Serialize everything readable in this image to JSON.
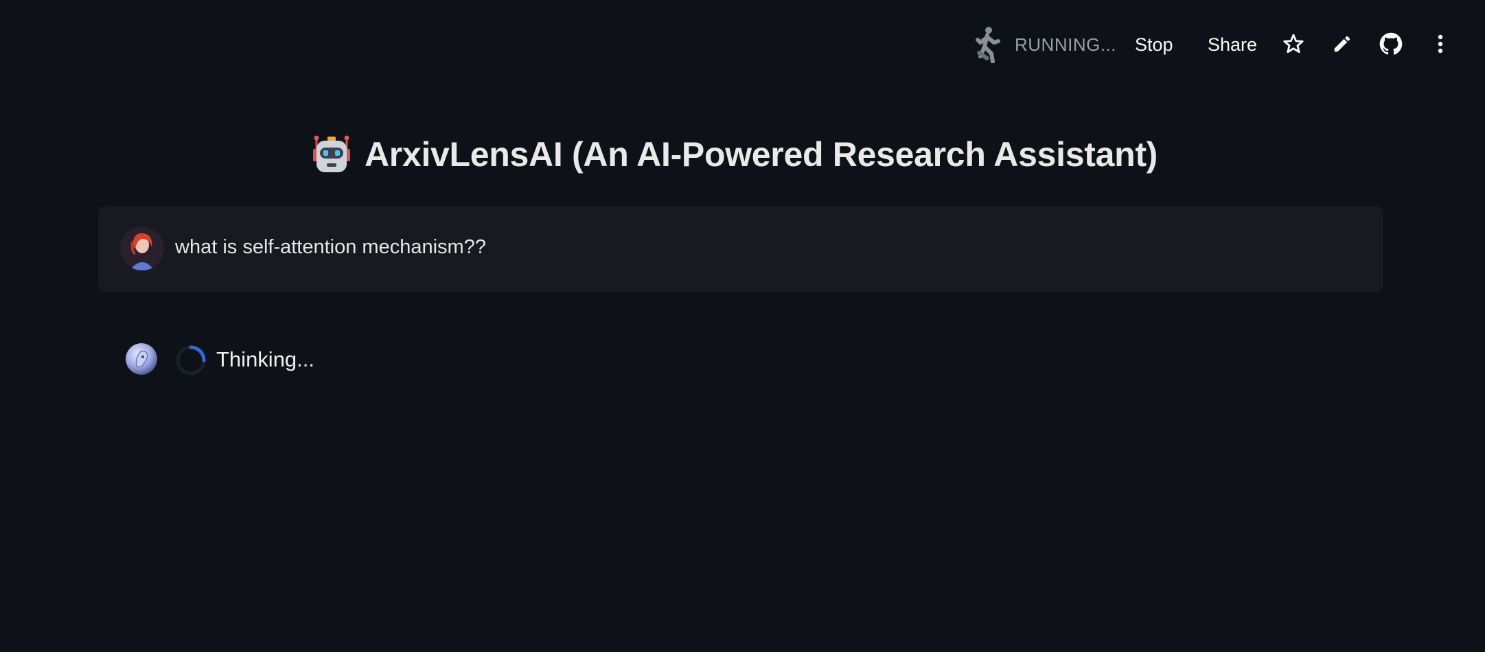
{
  "header": {
    "status_label": "RUNNING...",
    "stop_label": "Stop",
    "share_label": "Share",
    "icons": [
      "running-man-icon",
      "star-icon",
      "pencil-icon",
      "github-icon",
      "more-vertical-icon"
    ]
  },
  "main": {
    "title_icon": "robot-icon",
    "title": "ArxivLensAI (An AI-Powered Research Assistant)"
  },
  "chat": {
    "messages": [
      {
        "role": "user",
        "avatar": "user-avatar",
        "text": "what is self-attention mechanism??"
      },
      {
        "role": "assistant",
        "avatar": "assistant-avatar",
        "status": "Thinking..."
      }
    ]
  },
  "colors": {
    "background": "#0e1117",
    "user_bubble": "#171a20",
    "spinner_accent": "#2e6fd6",
    "text": "#fafafa"
  }
}
